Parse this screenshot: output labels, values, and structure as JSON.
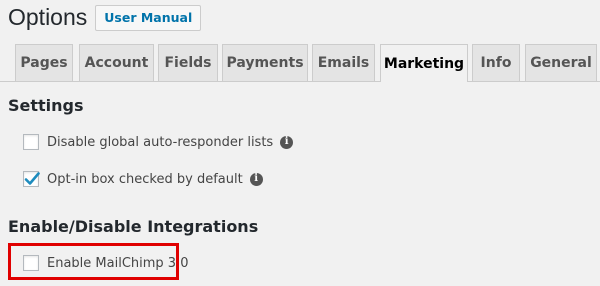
{
  "page": {
    "title": "Options",
    "user_manual_label": "User Manual"
  },
  "tabs": [
    {
      "label": "Pages",
      "active": false
    },
    {
      "label": "Account",
      "active": false
    },
    {
      "label": "Fields",
      "active": false
    },
    {
      "label": "Payments",
      "active": false
    },
    {
      "label": "Emails",
      "active": false
    },
    {
      "label": "Marketing",
      "active": true
    },
    {
      "label": "Info",
      "active": false
    },
    {
      "label": "General",
      "active": false
    }
  ],
  "settings": {
    "title": "Settings",
    "options": [
      {
        "label": "Disable global auto-responder lists",
        "checked": false,
        "icon": "info-icon"
      },
      {
        "label": "Opt-in box checked by default",
        "checked": true,
        "icon": "info-icon"
      }
    ]
  },
  "integrations": {
    "title": "Enable/Disable Integrations",
    "options": [
      {
        "label": "Enable MailChimp 3.0",
        "checked": false
      }
    ]
  },
  "colors": {
    "link": "#0073aa",
    "highlight": "#e00000",
    "checkmark": "#1e8cbe"
  }
}
